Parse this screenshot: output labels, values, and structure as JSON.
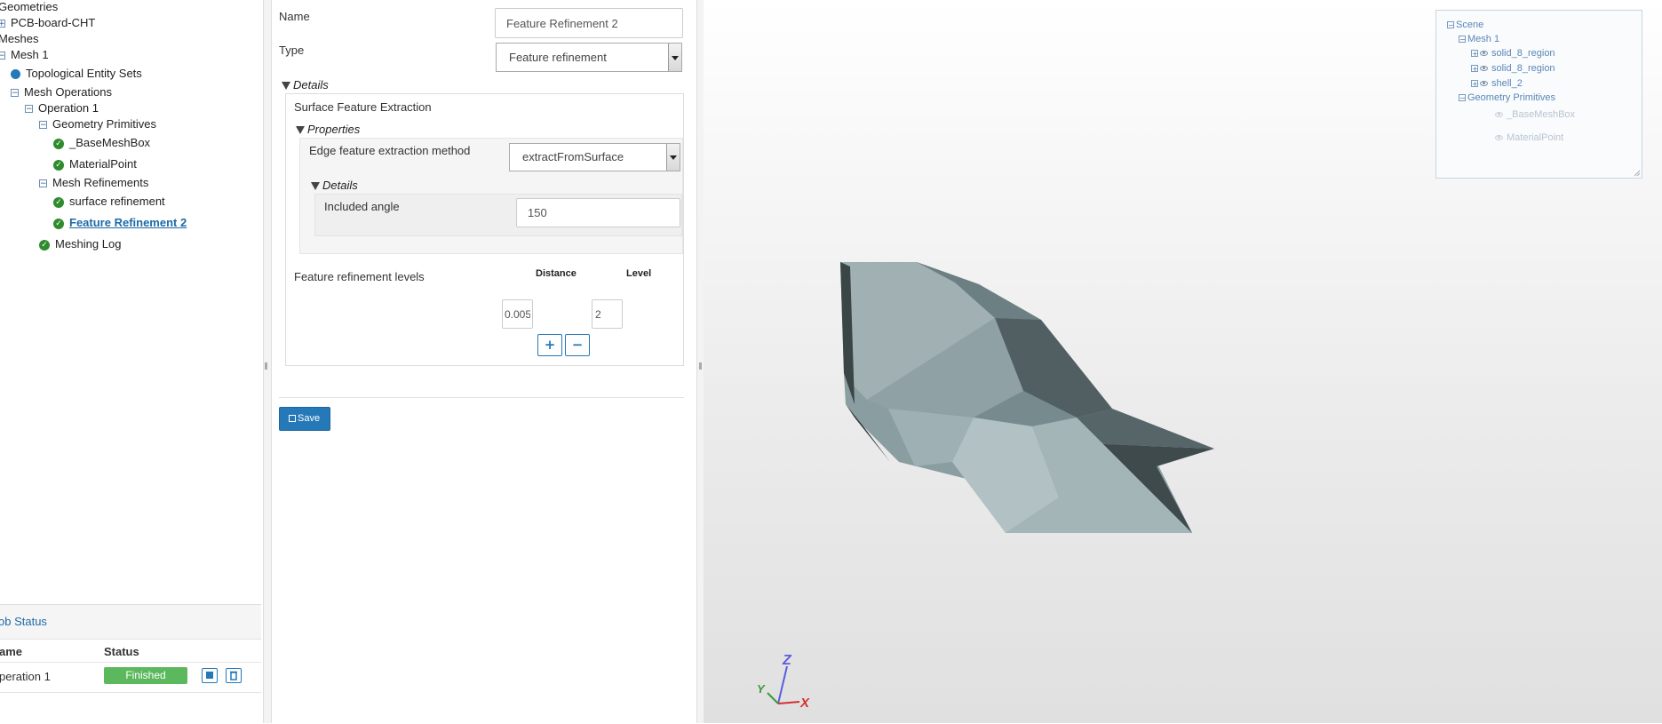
{
  "tree": {
    "geometries": "Geometries",
    "pcb_board": "PCB-board-CHT",
    "meshes": "Meshes",
    "mesh1": "Mesh 1",
    "topo_sets": "Topological Entity Sets",
    "mesh_ops": "Mesh Operations",
    "op1": "Operation 1",
    "geo_prims": "Geometry Primitives",
    "base_mesh_box": "_BaseMeshBox",
    "material_point": "MaterialPoint",
    "mesh_refs": "Mesh Refinements",
    "surface_ref": "surface refinement",
    "feature_ref2": "Feature Refinement 2",
    "meshing_log": "Meshing Log"
  },
  "job_status": {
    "title": "ob Status",
    "col_name": "ame",
    "col_status": "Status",
    "row_name": "peration 1",
    "row_status": "Finished"
  },
  "form": {
    "name_label": "Name",
    "name_value": "Feature Refinement 2",
    "type_label": "Type",
    "type_value": "Feature refinement",
    "details_title": "Details",
    "surface_feature_extraction": "Surface Feature Extraction",
    "properties_title": "Properties",
    "edge_method_label": "Edge feature extraction method",
    "edge_method_value": "extractFromSurface",
    "inner_details_title": "Details",
    "included_angle_label": "Included angle",
    "included_angle_value": "150",
    "levels_label": "Feature refinement levels",
    "distance_header": "Distance",
    "level_header": "Level",
    "distance_value": "0.005",
    "level_value": "2",
    "add_label": "+",
    "remove_label": "−",
    "save_label": "Save"
  },
  "scene": {
    "root": "Scene",
    "mesh1": "Mesh 1",
    "region1": "solid_8_region",
    "region2": "solid_8_region",
    "shell": "shell_2",
    "geo_prims": "Geometry Primitives",
    "base_mesh_box": "_BaseMeshBox",
    "material_point": "MaterialPoint"
  },
  "axes": {
    "x": "X",
    "y": "Y",
    "z": "Z"
  },
  "colors": {
    "accent": "#2679b8",
    "success": "#5cb85c",
    "check": "#2e8b2e",
    "model_fill": "#7f9396"
  }
}
